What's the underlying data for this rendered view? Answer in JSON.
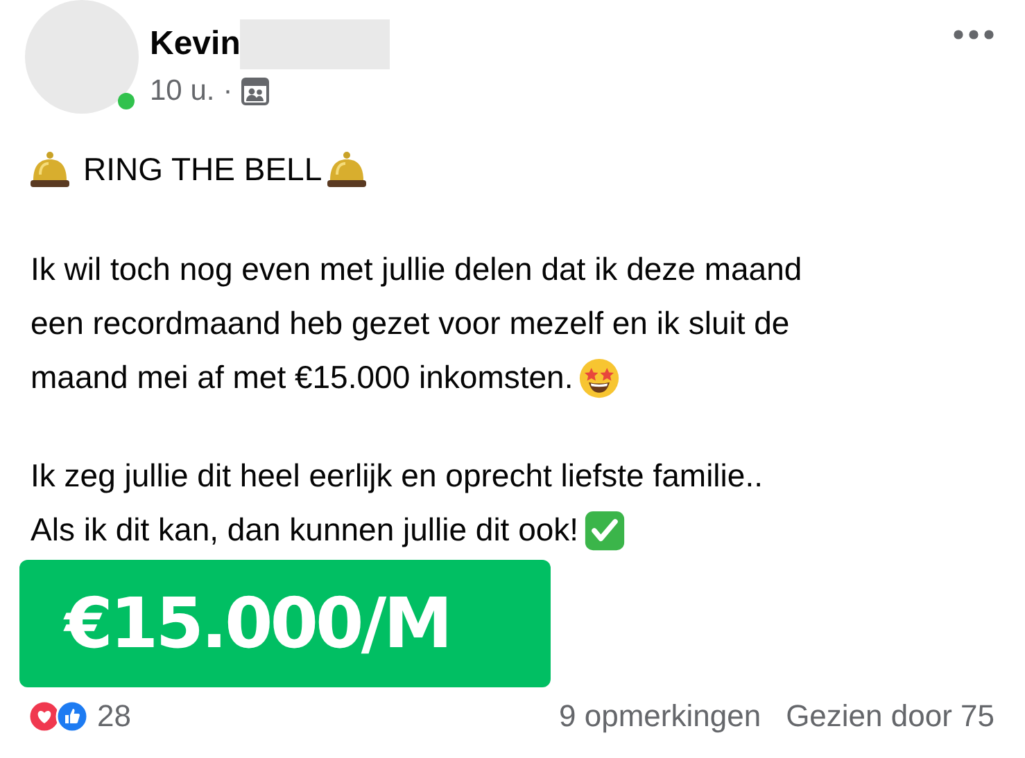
{
  "author": {
    "name": "Kevin",
    "name_redacted": true,
    "online": true
  },
  "meta": {
    "time": "10 u.",
    "separator": "·"
  },
  "post": {
    "headline": "RING THE BELL",
    "paragraphs": [
      {
        "lines": [
          "Ik wil toch nog even met jullie delen dat ik deze maand",
          "een recordmaand heb gezet voor mezelf en ik sluit de",
          "maand mei af met €15.000 inkomsten."
        ],
        "star_eyes_emoji": true,
        "check_emoji": false
      },
      {
        "lines": [
          "Ik zeg jullie dit heel eerlijk en oprecht liefste familie..",
          "Als ik dit kan, dan kunnen jullie dit ook!"
        ],
        "star_eyes_emoji": false,
        "check_emoji": true
      }
    ]
  },
  "banner": {
    "text": "€15.000/M"
  },
  "footer": {
    "reactions": "28",
    "comments": "9 opmerkingen",
    "views": "Gezien door 75"
  }
}
